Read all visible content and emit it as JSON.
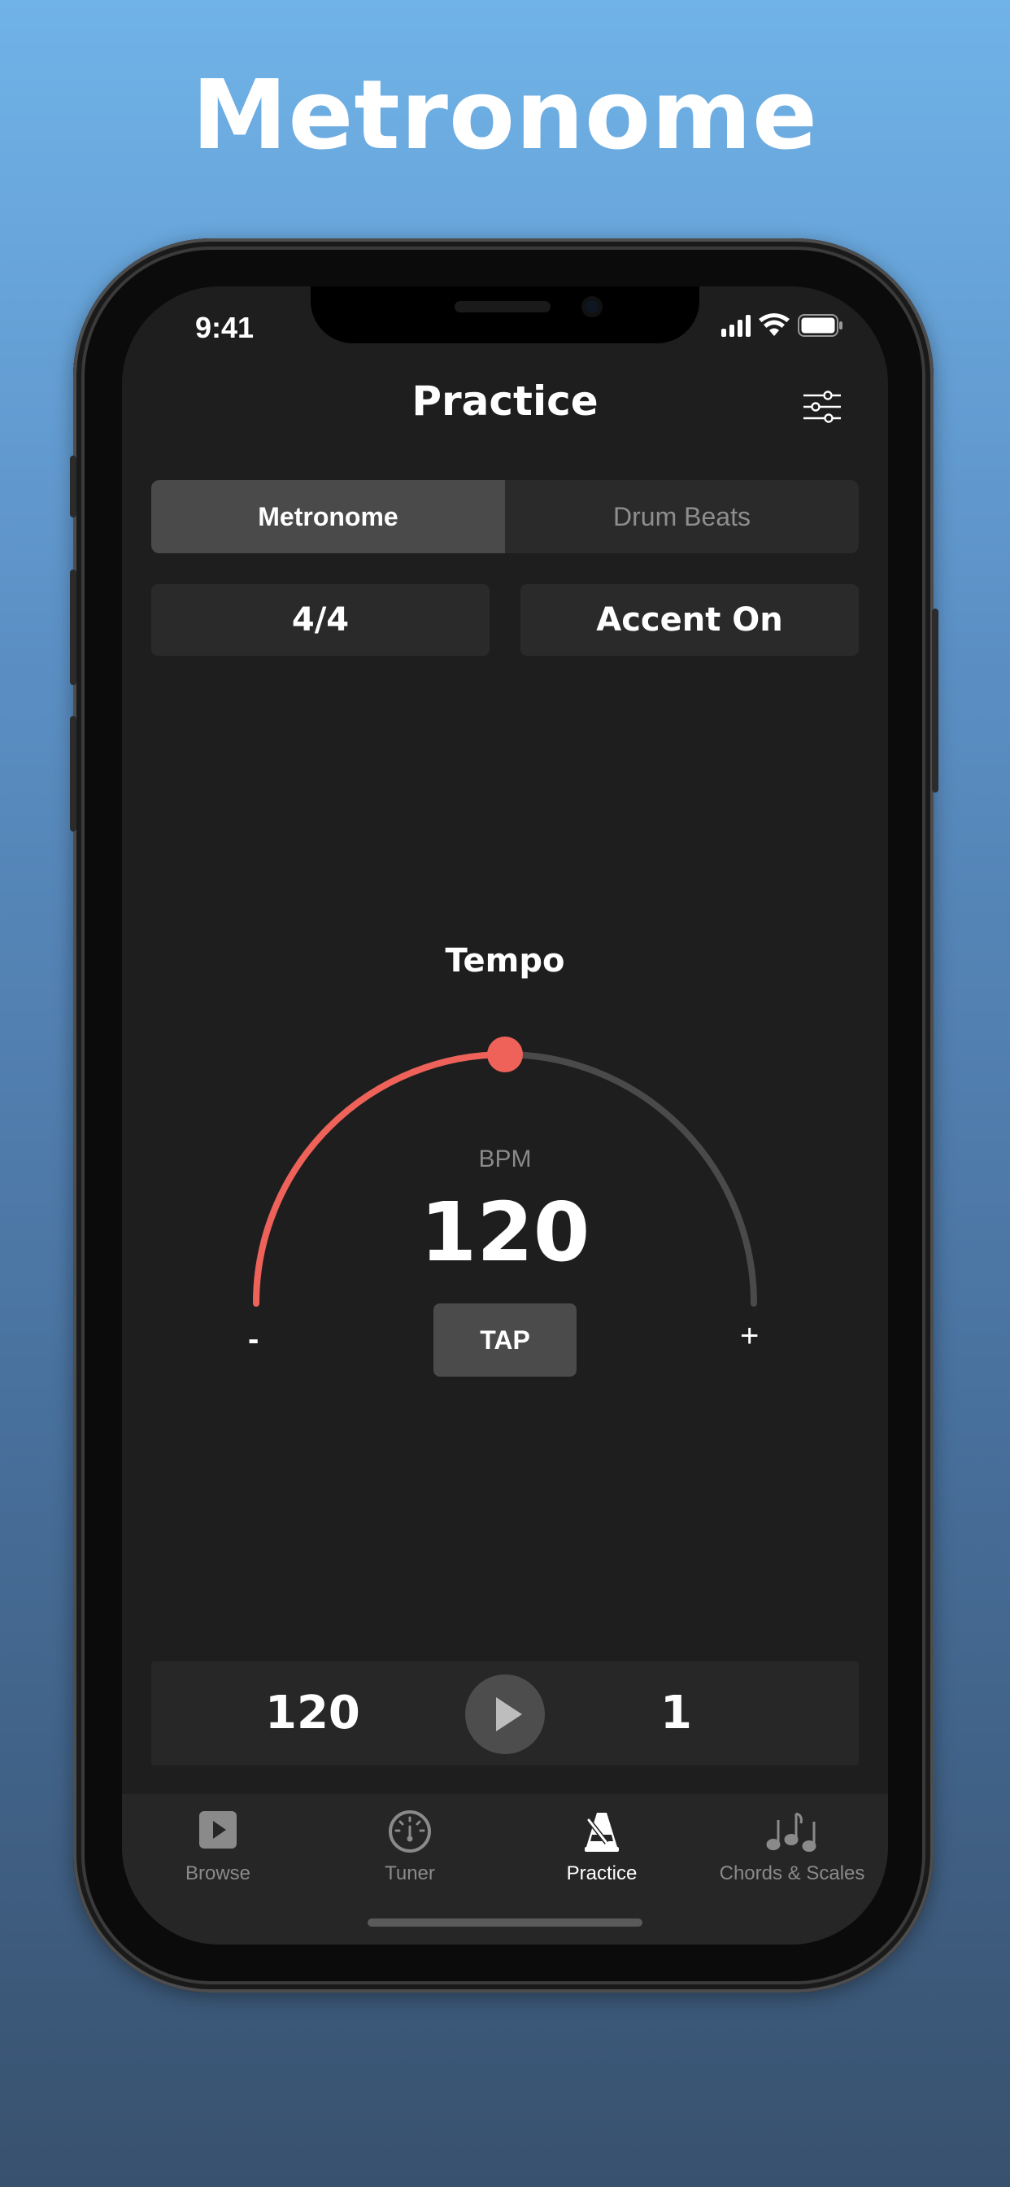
{
  "promo": {
    "title": "Metronome"
  },
  "status": {
    "time": "9:41"
  },
  "nav": {
    "title": "Practice"
  },
  "segments": [
    {
      "label": "Metronome",
      "active": true
    },
    {
      "label": "Drum Beats",
      "active": false
    }
  ],
  "options": {
    "time_signature": "4/4",
    "accent": "Accent On"
  },
  "tempo": {
    "label": "Tempo",
    "bpm_label": "BPM",
    "bpm_value": "120",
    "tap_label": "TAP",
    "minus_label": "-",
    "plus_label": "+",
    "level_fraction": 0.5
  },
  "transport": {
    "bpm": "120",
    "beat": "1"
  },
  "tabs": [
    {
      "label": "Browse",
      "icon": "play-box-icon"
    },
    {
      "label": "Tuner",
      "icon": "tuner-gauge-icon"
    },
    {
      "label": "Practice",
      "icon": "metronome-icon",
      "active": true
    },
    {
      "label": "Chords & Scales",
      "icon": "music-notes-icon"
    }
  ],
  "colors": {
    "accent": "#ee6259",
    "track": "#4a4a4a",
    "background": "#1e1e1e"
  }
}
